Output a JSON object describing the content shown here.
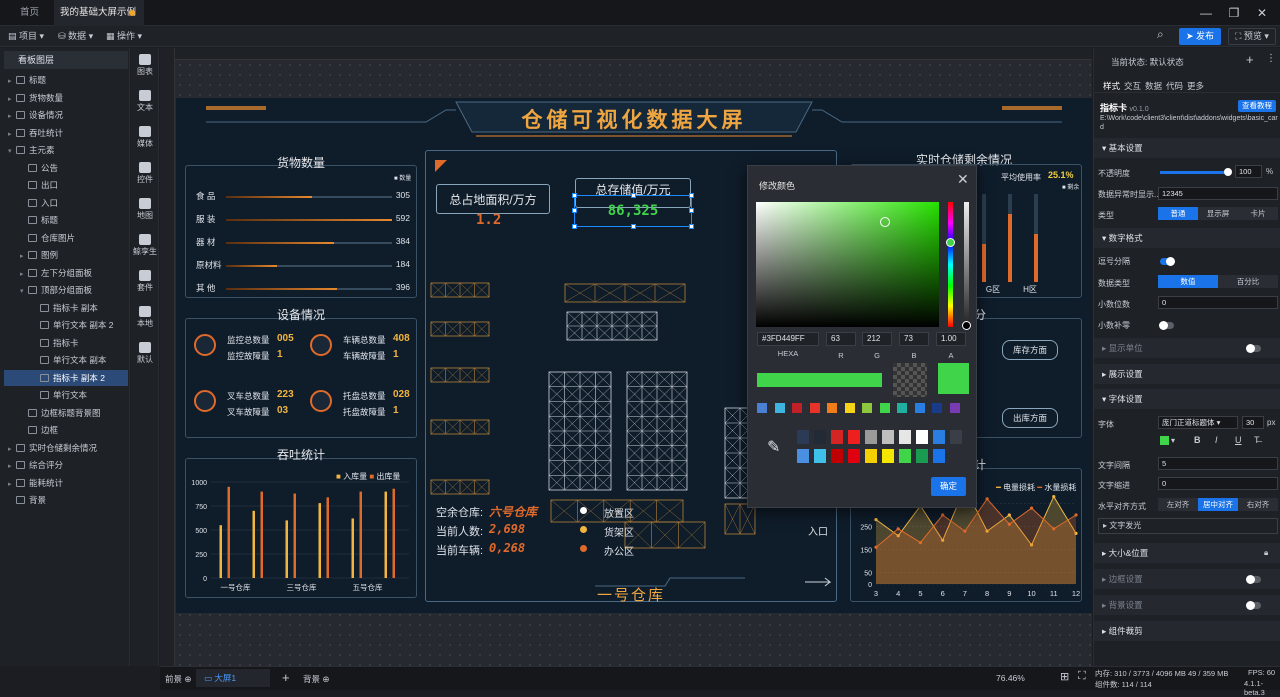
{
  "titlebar": {
    "home_tab": "首页",
    "active_tab": "我的基础大屏示例"
  },
  "toolbar": {
    "project": "项目",
    "data": "数据",
    "ops": "操作",
    "publish": "发布",
    "preview": "预览"
  },
  "layers": {
    "header": "看板图层",
    "items": [
      {
        "label": "标题",
        "lv": 0,
        "ar": "▸"
      },
      {
        "label": "货物数量",
        "lv": 0,
        "ar": "▸"
      },
      {
        "label": "设备情况",
        "lv": 0,
        "ar": "▸"
      },
      {
        "label": "吞吐统计",
        "lv": 0,
        "ar": "▸"
      },
      {
        "label": "主元素",
        "lv": 0,
        "ar": "▾"
      },
      {
        "label": "公告",
        "lv": 1,
        "ar": ""
      },
      {
        "label": "出口",
        "lv": 1,
        "ar": ""
      },
      {
        "label": "入口",
        "lv": 1,
        "ar": ""
      },
      {
        "label": "标题",
        "lv": 1,
        "ar": ""
      },
      {
        "label": "仓库图片",
        "lv": 1,
        "ar": ""
      },
      {
        "label": "图例",
        "lv": 1,
        "ar": "▸"
      },
      {
        "label": "左下分组面板",
        "lv": 1,
        "ar": "▸"
      },
      {
        "label": "顶部分组面板",
        "lv": 1,
        "ar": "▾"
      },
      {
        "label": "指标卡 副本",
        "lv": 2,
        "ar": ""
      },
      {
        "label": "单行文本 副本 2",
        "lv": 2,
        "ar": ""
      },
      {
        "label": "指标卡",
        "lv": 2,
        "ar": ""
      },
      {
        "label": "单行文本 副本",
        "lv": 2,
        "ar": ""
      },
      {
        "label": "指标卡 副本 2",
        "lv": 2,
        "ar": "",
        "sel": true
      },
      {
        "label": "单行文本",
        "lv": 2,
        "ar": ""
      },
      {
        "label": "边框标题背景图",
        "lv": 1,
        "ar": ""
      },
      {
        "label": "边框",
        "lv": 1,
        "ar": ""
      },
      {
        "label": "实时仓储剩余情况",
        "lv": 0,
        "ar": "▸"
      },
      {
        "label": "综合评分",
        "lv": 0,
        "ar": "▸"
      },
      {
        "label": "能耗统计",
        "lv": 0,
        "ar": "▸"
      },
      {
        "label": "背景",
        "lv": 0,
        "ar": ""
      }
    ]
  },
  "palette": [
    "图表",
    "文本",
    "媒体",
    "控件",
    "地图",
    "鲸孪生",
    "套件",
    "本地",
    "默认"
  ],
  "screen": {
    "title": "仓储可视化数据大屏",
    "cargo": {
      "title": "货物数量",
      "legend": "数量",
      "items": [
        {
          "label": "食 品",
          "value": "305",
          "pct": 0.52
        },
        {
          "label": "服 装",
          "value": "592",
          "pct": 1.0
        },
        {
          "label": "器 材",
          "value": "384",
          "pct": 0.65
        },
        {
          "label": "原材料",
          "value": "184",
          "pct": 0.31
        },
        {
          "label": "其 他",
          "value": "396",
          "pct": 0.67
        }
      ]
    },
    "equip": {
      "title": "设备情况",
      "cells": [
        {
          "l1": "监控总数量",
          "v1": "005",
          "l2": "监控故障量",
          "v2": "1"
        },
        {
          "l1": "车辆总数量",
          "v1": "408",
          "l2": "车辆故障量",
          "v2": "1"
        },
        {
          "l1": "叉车总数量",
          "v1": "223",
          "l2": "叉车故障量",
          "v2": "03"
        },
        {
          "l1": "托盘总数量",
          "v1": "028",
          "l2": "托盘故障量",
          "v2": "1"
        }
      ]
    },
    "throughput": {
      "title": "吞吐统计"
    },
    "center": {
      "card1_label": "总占地面积/万方",
      "card1_value": "1.2",
      "card2_label": "总存储值/万元",
      "card2_value": "86,325",
      "stats": [
        {
          "label": "空余仓库:",
          "value": "六号仓库"
        },
        {
          "label": "当前人数:",
          "value": "2,698"
        },
        {
          "label": "当前车辆:",
          "value": "0,268"
        }
      ],
      "zones": [
        "放置区",
        "货架区",
        "办公区"
      ],
      "entrance": "入口",
      "warehouse_name": "一号仓库"
    },
    "storage": {
      "title": "实时仓储剩余情况",
      "usage_label": "平均使用率",
      "usage_value": "25.1%",
      "legend": "剩余",
      "xlabels": [
        "F区",
        "G区",
        "H区"
      ]
    },
    "right_mid": {
      "btn1": "库存方面",
      "btn2": "出库方面",
      "title_part": "分"
    },
    "energy": {
      "title_part": "计",
      "legend": [
        "电量损耗",
        "水量损耗"
      ]
    }
  },
  "chart_data": [
    {
      "type": "bar",
      "title": "吞吐统计",
      "categories": [
        "一号仓库",
        "",
        "三号仓库",
        "",
        "五号仓库",
        ""
      ],
      "series": [
        {
          "name": "入库量",
          "values": [
            550,
            700,
            600,
            780,
            620,
            900
          ]
        },
        {
          "name": "出库量",
          "values": [
            950,
            900,
            880,
            840,
            900,
            930
          ]
        }
      ],
      "ylim": [
        0,
        1000
      ],
      "yticks": [
        0,
        250,
        500,
        750,
        1000
      ],
      "legend": "top-right"
    },
    {
      "type": "area",
      "categories": [
        "3",
        "4",
        "5",
        "6",
        "7",
        "8",
        "9",
        "10",
        "11",
        "12"
      ],
      "series": [
        {
          "name": "电量损耗",
          "values": [
            280,
            210,
            340,
            190,
            420,
            230,
            300,
            170,
            380,
            220
          ]
        },
        {
          "name": "水量损耗",
          "values": [
            160,
            240,
            180,
            300,
            230,
            370,
            260,
            330,
            240,
            300
          ]
        }
      ],
      "ylim": [
        0,
        400
      ],
      "yticks": [
        0,
        50,
        150,
        250,
        350
      ],
      "legend": "top-right"
    }
  ],
  "picker": {
    "title": "修改颜色",
    "hex": "#3FD449FF",
    "r": "63",
    "g": "212",
    "b": "73",
    "a": "1.00",
    "labels": [
      "HEXA",
      "R",
      "G",
      "B",
      "A"
    ],
    "preview_color": "#3fd449",
    "row1": [
      "#4a7fd4",
      "#3fb4e0",
      "#c0202a",
      "#e8332a",
      "#f07d1a",
      "#f5d31a",
      "#8dc63f",
      "#3fd449",
      "#1fb0a0",
      "#2a7de1",
      "#1a3a8a",
      "#7a3ab4"
    ],
    "swatch_grid": [
      "#2b3a55",
      "#222a36",
      "#d42424",
      "#ee1f1f",
      "#9a9a9a",
      "#bfbfbf",
      "#e6e6e6",
      "#ffffff",
      "#2a7de1",
      "#3a3e46",
      "#4a90e2",
      "#3fc0e8",
      "#c00000",
      "#e00010",
      "#f5d000",
      "#f5e600",
      "#3fd449",
      "#1a9c50",
      "#1a73e8"
    ],
    "ok": "确定"
  },
  "rpanel": {
    "state_label": "当前状态:",
    "state_value": "默认状态",
    "tabs": [
      "样式",
      "交互",
      "数据",
      "代码",
      "更多"
    ],
    "comp_name": "指标卡",
    "comp_ver": "v0.1.0",
    "tutorial": "查看教程",
    "path": "E:\\Work\\code\\client3\\client\\dist\\addons\\widgets\\basic_card",
    "sec_basic": "基本设置",
    "opacity_label": "不透明度",
    "opacity_value": "100",
    "opacity_unit": "%",
    "error_label": "数据异常时显示...",
    "error_value": "12345",
    "type_label": "类型",
    "type_opts": [
      "普通",
      "显示屏",
      "卡片"
    ],
    "sec_number": "数字格式",
    "sep_label": "逗号分隔",
    "dtype_label": "数据类型",
    "dtype_opts": [
      "数值",
      "百分比"
    ],
    "decimal_label": "小数位数",
    "decimal_value": "0",
    "pad_label": "小数补零",
    "sec_unit": "显示单位",
    "sec_show": "展示设置",
    "sec_font": "字体设置",
    "font_label": "字体",
    "font_value": "庞门正道标题体",
    "font_size": "30",
    "font_unit": "px",
    "spacing_label": "文字间隔",
    "spacing_value": "5",
    "indent_label": "文字缩进",
    "indent_value": "0",
    "align_label": "水平对齐方式",
    "align_opts": [
      "左对齐",
      "居中对齐",
      "右对齐"
    ],
    "glow_label": "文字发光",
    "sec_size": "大小&位置",
    "sec_border": "边框设置",
    "sec_bg": "背景设置",
    "sec_clip": "组件裁剪",
    "font_color": "#3fd449"
  },
  "bottom": {
    "front": "前景",
    "screen_tab": "大屏1",
    "bg": "背景",
    "zoom": "76.46%",
    "mem": "内存: 310 / 3773 / 4096 MB  49 / 359 MB",
    "fps_label": "FPS:",
    "fps_value": "60",
    "count": "组件数: 114 / 114",
    "ver": "4.1.1-beta.3"
  }
}
